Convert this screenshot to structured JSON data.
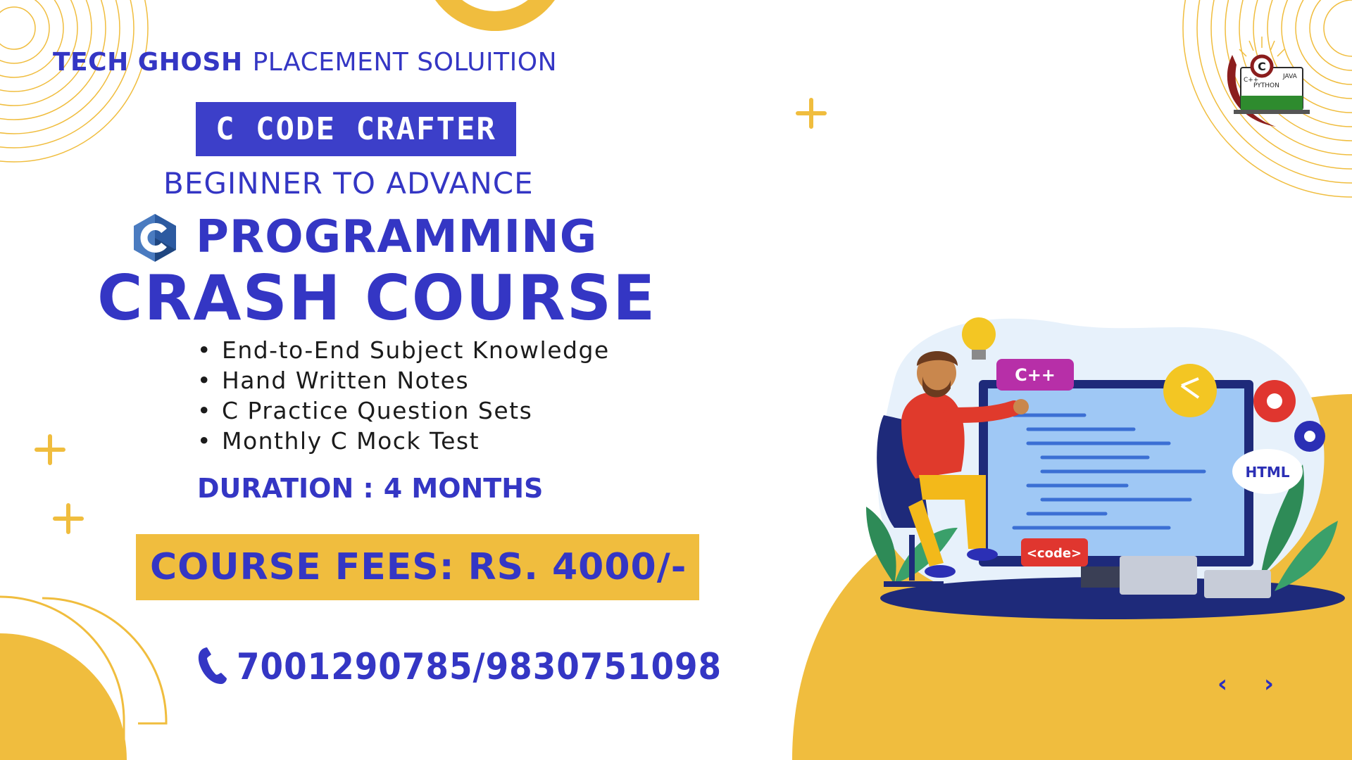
{
  "brand": {
    "name": "TECH GHOSH",
    "tagline": "PLACEMENT SOLUITION"
  },
  "course": {
    "badge": "C CODE CRAFTER",
    "level": "BEGINNER TO ADVANCE",
    "language": "PROGRAMMING",
    "type": "CRASH COURSE",
    "features": [
      "End-to-End Subject Knowledge",
      "Hand Written Notes",
      "C Practice Question Sets",
      "Monthly C Mock Test"
    ],
    "duration_label": "DURATION :",
    "duration_value": "4 MONTHS",
    "fees": "COURSE FEES: RS. 4000/-",
    "phone": "7001290785/9830751098"
  },
  "logo": {
    "labels": [
      "C",
      "C++",
      "JAVA",
      "PYTHON"
    ]
  },
  "illustration": {
    "tags": [
      "C++",
      "HTML",
      "<code>"
    ]
  },
  "nav": {
    "prev": "‹",
    "next": "›"
  },
  "colors": {
    "primary": "#3436c4",
    "accent": "#f0bd3e",
    "text": "#1b1b1b"
  }
}
